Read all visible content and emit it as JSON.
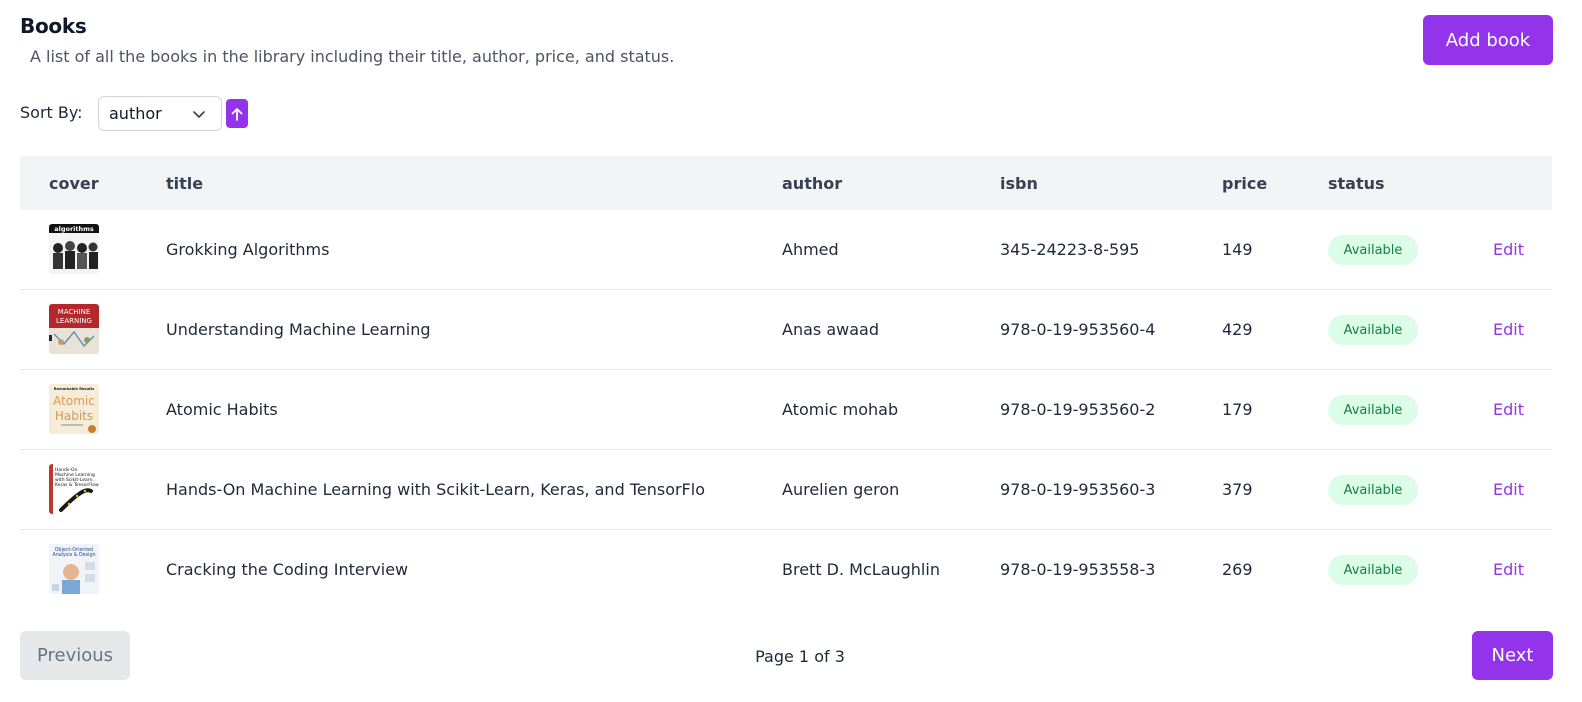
{
  "header": {
    "title": "Books",
    "subtitle": "A list of all the books in the library including their title, author, price, and status.",
    "add_label": "Add book"
  },
  "sort": {
    "label": "Sort By:",
    "selected": "author",
    "direction": "ascending",
    "icon": "arrow-up-icon"
  },
  "table": {
    "columns": [
      "cover",
      "title",
      "author",
      "isbn",
      "price",
      "status"
    ],
    "edit_label": "Edit",
    "rows": [
      {
        "cover_art": "grokking-cover",
        "title": "Grokking Algorithms",
        "author": "Ahmed",
        "isbn": "345-24223-8-595",
        "price": "149",
        "status": "Available"
      },
      {
        "cover_art": "machine-learning-cover",
        "title": "Understanding Machine Learning",
        "author": "Anas awaad",
        "isbn": "978-0-19-953560-4",
        "price": "429",
        "status": "Available"
      },
      {
        "cover_art": "atomic-habits-cover",
        "title": "Atomic Habits",
        "author": "Atomic mohab",
        "isbn": "978-0-19-953560-2",
        "price": "179",
        "status": "Available"
      },
      {
        "cover_art": "hands-on-ml-cover",
        "title": "Hands-On Machine Learning with Scikit-Learn, Keras, and TensorFlo",
        "author": "Aurelien geron",
        "isbn": "978-0-19-953560-3",
        "price": "379",
        "status": "Available"
      },
      {
        "cover_art": "ooad-cover",
        "title": "Cracking the Coding Interview",
        "author": "Brett D. McLaughlin",
        "isbn": "978-0-19-953558-3",
        "price": "269",
        "status": "Available"
      }
    ]
  },
  "covers": {
    "grokking": "algorithms",
    "ml_line1": "MACHINE",
    "ml_line2": "LEARNING",
    "atomic_top": "Remarkable Results",
    "atomic_line1": "Atomic",
    "atomic_line2": "Habits",
    "handson_line1": "Hands-On",
    "handson_line2": "Machine Learning",
    "handson_line3": "with Scikit-Learn,",
    "handson_line4": "Keras & TensorFlow",
    "ooad_line1": "Object-Oriented",
    "ooad_line2": "Analysis & Design"
  },
  "pagination": {
    "previous_label": "Previous",
    "indicator": "Page 1 of 3",
    "next_label": "Next"
  },
  "colors": {
    "accent": "#9333ea",
    "status_bg": "#dcfce7",
    "status_text": "#15803d",
    "header_bg": "#f3f4f6"
  }
}
